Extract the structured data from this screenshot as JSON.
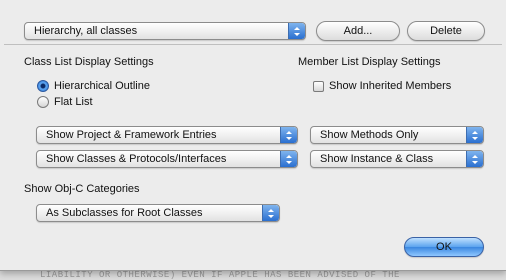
{
  "top": {
    "hierarchy_popup": "Hierarchy, all classes",
    "add_button": "Add...",
    "delete_button": "Delete"
  },
  "class_list": {
    "heading": "Class List Display Settings",
    "radio_hierarchical": "Hierarchical Outline",
    "radio_flat": "Flat List",
    "hierarchical_selected": true,
    "popup_entries": "Show Project & Framework Entries",
    "popup_classes": "Show Classes & Protocols/Interfaces"
  },
  "member_list": {
    "heading": "Member List Display Settings",
    "checkbox_inherited": "Show Inherited Members",
    "inherited_checked": false,
    "popup_methods": "Show Methods Only",
    "popup_instance": "Show Instance & Class"
  },
  "categories": {
    "heading": "Show Obj-C Categories",
    "popup_value": "As Subclasses for Root Classes"
  },
  "ok_button": "OK",
  "accent_color": "#3a87e0"
}
